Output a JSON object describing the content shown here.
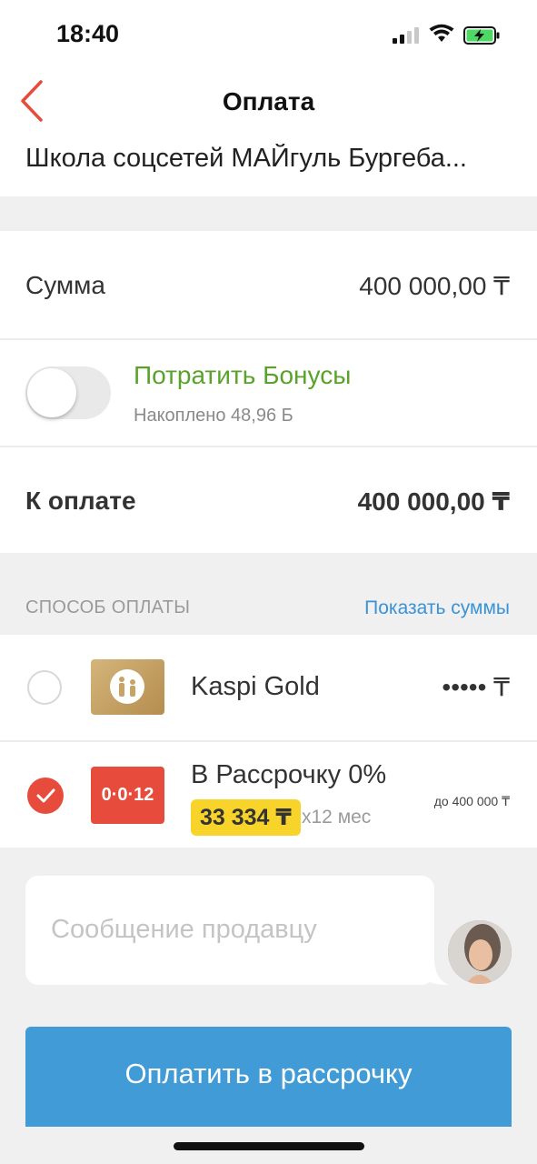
{
  "status": {
    "time": "18:40"
  },
  "header": {
    "title": "Оплата",
    "merchant": "Школа соцсетей МАЙгуль Бургеба..."
  },
  "summary": {
    "amount_label": "Сумма",
    "amount_value": "400 000,00 ₸",
    "bonus_title": "Потратить Бонусы",
    "bonus_sub": "Накоплено 48,96 Б",
    "bonus_enabled": false,
    "total_label": "К оплате",
    "total_value": "400 000,00 ₸"
  },
  "payment": {
    "section_label": "СПОСОБ ОПЛАТЫ",
    "show_sums": "Показать суммы",
    "methods": [
      {
        "name": "Kaspi Gold",
        "amount": "••••• ₸",
        "selected": false,
        "icon": "kaspi-gold-card-icon"
      },
      {
        "name": "В Рассрочку 0%",
        "badge": "0·0·12",
        "monthly": "33 334 ₸",
        "months": "x12 мес",
        "limit": "до 400 000 ₸",
        "selected": true,
        "icon": "installment-card-icon"
      }
    ]
  },
  "message": {
    "placeholder": "Сообщение продавцу"
  },
  "pay_button": {
    "label": "Оплатить в рассрочку"
  },
  "colors": {
    "accent": "#e74b3c",
    "blue": "#419bd6",
    "green": "#5aa32a",
    "yellow": "#f8d32a"
  }
}
